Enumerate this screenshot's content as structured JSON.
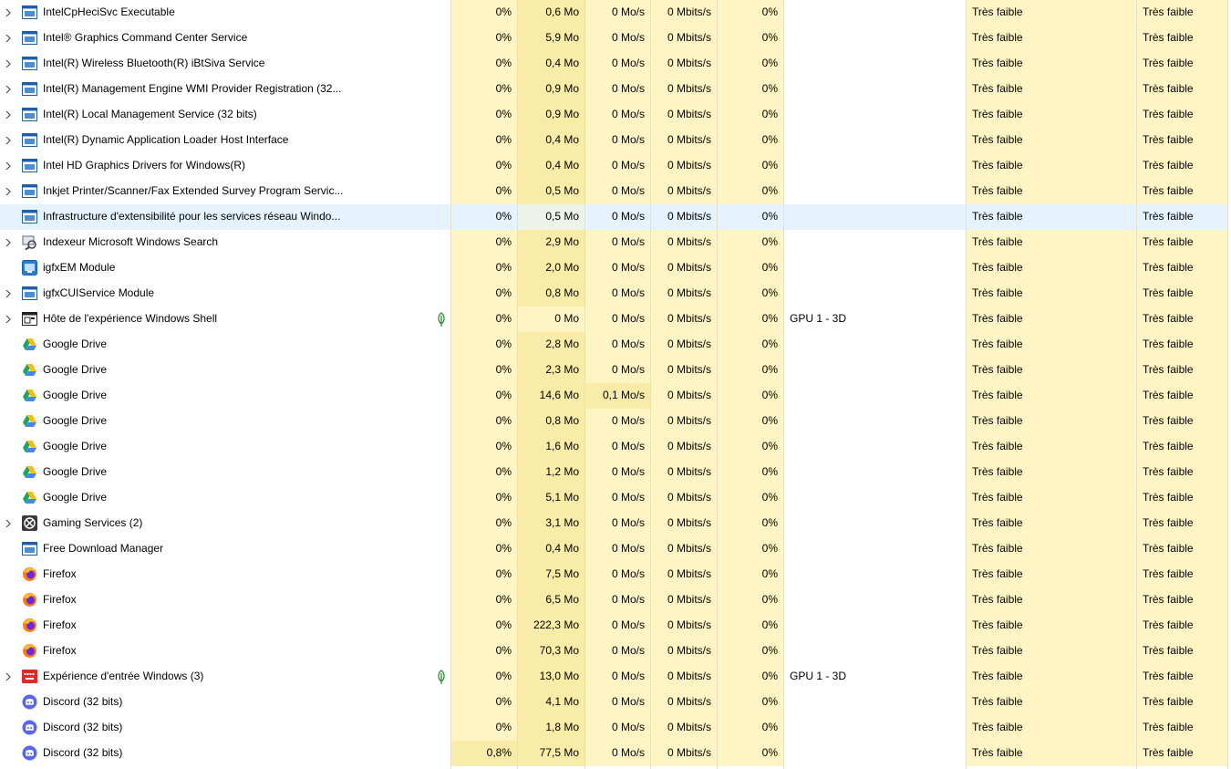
{
  "colors": {
    "heat": "#fff4c4",
    "heat_strong": "#f9eca8",
    "selection": "#e5f3ff",
    "leaf": "#2e8b2e"
  },
  "rows": [
    {
      "name": "IntelCpHeciSvc Executable",
      "icon": "service-window-icon",
      "expand": true,
      "cpu": "0%",
      "mem": "0,6 Mo",
      "disk": "0 Mo/s",
      "net": "0 Mbits/s",
      "gpu": "0%",
      "gpu_engine": "",
      "power": "Très faible",
      "power_trend": "Très faible"
    },
    {
      "name": "Intel® Graphics Command Center Service",
      "icon": "service-window-icon",
      "expand": true,
      "cpu": "0%",
      "mem": "5,9 Mo",
      "disk": "0 Mo/s",
      "net": "0 Mbits/s",
      "gpu": "0%",
      "gpu_engine": "",
      "power": "Très faible",
      "power_trend": "Très faible"
    },
    {
      "name": "Intel(R) Wireless Bluetooth(R) iBtSiva Service",
      "icon": "service-window-icon",
      "expand": true,
      "cpu": "0%",
      "mem": "0,4 Mo",
      "disk": "0 Mo/s",
      "net": "0 Mbits/s",
      "gpu": "0%",
      "gpu_engine": "",
      "power": "Très faible",
      "power_trend": "Très faible"
    },
    {
      "name": "Intel(R) Management Engine WMI Provider Registration (32...",
      "icon": "service-window-icon",
      "expand": true,
      "cpu": "0%",
      "mem": "0,9 Mo",
      "disk": "0 Mo/s",
      "net": "0 Mbits/s",
      "gpu": "0%",
      "gpu_engine": "",
      "power": "Très faible",
      "power_trend": "Très faible"
    },
    {
      "name": "Intel(R) Local Management Service (32 bits)",
      "icon": "service-window-icon",
      "expand": true,
      "cpu": "0%",
      "mem": "0,9 Mo",
      "disk": "0 Mo/s",
      "net": "0 Mbits/s",
      "gpu": "0%",
      "gpu_engine": "",
      "power": "Très faible",
      "power_trend": "Très faible"
    },
    {
      "name": "Intel(R) Dynamic Application Loader Host Interface",
      "icon": "service-window-icon",
      "expand": true,
      "cpu": "0%",
      "mem": "0,4 Mo",
      "disk": "0 Mo/s",
      "net": "0 Mbits/s",
      "gpu": "0%",
      "gpu_engine": "",
      "power": "Très faible",
      "power_trend": "Très faible"
    },
    {
      "name": "Intel HD Graphics Drivers for Windows(R)",
      "icon": "service-window-icon",
      "expand": true,
      "cpu": "0%",
      "mem": "0,4 Mo",
      "disk": "0 Mo/s",
      "net": "0 Mbits/s",
      "gpu": "0%",
      "gpu_engine": "",
      "power": "Très faible",
      "power_trend": "Très faible"
    },
    {
      "name": "Inkjet Printer/Scanner/Fax Extended Survey Program Servic...",
      "icon": "service-window-icon",
      "expand": true,
      "cpu": "0%",
      "mem": "0,5 Mo",
      "disk": "0 Mo/s",
      "net": "0 Mbits/s",
      "gpu": "0%",
      "gpu_engine": "",
      "power": "Très faible",
      "power_trend": "Très faible"
    },
    {
      "name": "Infrastructure d'extensibilité pour les services réseau Windo...",
      "icon": "service-window-icon",
      "expand": false,
      "selected": true,
      "cpu": "0%",
      "mem": "0,5 Mo",
      "disk": "0 Mo/s",
      "net": "0 Mbits/s",
      "gpu": "0%",
      "gpu_engine": "",
      "power": "Très faible",
      "power_trend": "Très faible"
    },
    {
      "name": "Indexeur Microsoft Windows Search",
      "icon": "search-indexer-icon",
      "expand": true,
      "cpu": "0%",
      "mem": "2,9 Mo",
      "disk": "0 Mo/s",
      "net": "0 Mbits/s",
      "gpu": "0%",
      "gpu_engine": "",
      "power": "Très faible",
      "power_trend": "Très faible"
    },
    {
      "name": "igfxEM Module",
      "icon": "igfx-module-icon",
      "expand": false,
      "cpu": "0%",
      "mem": "2,0 Mo",
      "disk": "0 Mo/s",
      "net": "0 Mbits/s",
      "gpu": "0%",
      "gpu_engine": "",
      "power": "Très faible",
      "power_trend": "Très faible"
    },
    {
      "name": "igfxCUIService Module",
      "icon": "service-window-icon",
      "expand": true,
      "cpu": "0%",
      "mem": "0,8 Mo",
      "disk": "0 Mo/s",
      "net": "0 Mbits/s",
      "gpu": "0%",
      "gpu_engine": "",
      "power": "Très faible",
      "power_trend": "Très faible"
    },
    {
      "name": "Hôte de l'expérience Windows Shell",
      "icon": "shell-host-icon",
      "expand": true,
      "leaf": true,
      "mem_plain": true,
      "cpu": "0%",
      "mem": "0 Mo",
      "disk": "0 Mo/s",
      "net": "0 Mbits/s",
      "gpu": "0%",
      "gpu_engine": "GPU 1 - 3D",
      "power": "Très faible",
      "power_trend": "Très faible"
    },
    {
      "name": "Google Drive",
      "icon": "google-drive-icon",
      "expand": false,
      "cpu": "0%",
      "mem": "2,8 Mo",
      "disk": "0 Mo/s",
      "net": "0 Mbits/s",
      "gpu": "0%",
      "gpu_engine": "",
      "power": "Très faible",
      "power_trend": "Très faible"
    },
    {
      "name": "Google Drive",
      "icon": "google-drive-icon",
      "expand": false,
      "cpu": "0%",
      "mem": "2,3 Mo",
      "disk": "0 Mo/s",
      "net": "0 Mbits/s",
      "gpu": "0%",
      "gpu_engine": "",
      "power": "Très faible",
      "power_trend": "Très faible"
    },
    {
      "name": "Google Drive",
      "icon": "google-drive-icon",
      "expand": false,
      "disk_strong": true,
      "cpu": "0%",
      "mem": "14,6 Mo",
      "disk": "0,1 Mo/s",
      "net": "0 Mbits/s",
      "gpu": "0%",
      "gpu_engine": "",
      "power": "Très faible",
      "power_trend": "Très faible"
    },
    {
      "name": "Google Drive",
      "icon": "google-drive-icon",
      "expand": false,
      "cpu": "0%",
      "mem": "0,8 Mo",
      "disk": "0 Mo/s",
      "net": "0 Mbits/s",
      "gpu": "0%",
      "gpu_engine": "",
      "power": "Très faible",
      "power_trend": "Très faible"
    },
    {
      "name": "Google Drive",
      "icon": "google-drive-icon",
      "expand": false,
      "cpu": "0%",
      "mem": "1,6 Mo",
      "disk": "0 Mo/s",
      "net": "0 Mbits/s",
      "gpu": "0%",
      "gpu_engine": "",
      "power": "Très faible",
      "power_trend": "Très faible"
    },
    {
      "name": "Google Drive",
      "icon": "google-drive-icon",
      "expand": false,
      "cpu": "0%",
      "mem": "1,2 Mo",
      "disk": "0 Mo/s",
      "net": "0 Mbits/s",
      "gpu": "0%",
      "gpu_engine": "",
      "power": "Très faible",
      "power_trend": "Très faible"
    },
    {
      "name": "Google Drive",
      "icon": "google-drive-icon",
      "expand": false,
      "cpu": "0%",
      "mem": "5,1 Mo",
      "disk": "0 Mo/s",
      "net": "0 Mbits/s",
      "gpu": "0%",
      "gpu_engine": "",
      "power": "Très faible",
      "power_trend": "Très faible"
    },
    {
      "name": "Gaming Services (2)",
      "icon": "xbox-icon",
      "expand": true,
      "cpu": "0%",
      "mem": "3,1 Mo",
      "disk": "0 Mo/s",
      "net": "0 Mbits/s",
      "gpu": "0%",
      "gpu_engine": "",
      "power": "Très faible",
      "power_trend": "Très faible"
    },
    {
      "name": "Free Download Manager",
      "icon": "service-window-icon",
      "expand": false,
      "cpu": "0%",
      "mem": "0,4 Mo",
      "disk": "0 Mo/s",
      "net": "0 Mbits/s",
      "gpu": "0%",
      "gpu_engine": "",
      "power": "Très faible",
      "power_trend": "Très faible"
    },
    {
      "name": "Firefox",
      "icon": "firefox-icon",
      "expand": false,
      "cpu": "0%",
      "mem": "7,5 Mo",
      "disk": "0 Mo/s",
      "net": "0 Mbits/s",
      "gpu": "0%",
      "gpu_engine": "",
      "power": "Très faible",
      "power_trend": "Très faible"
    },
    {
      "name": "Firefox",
      "icon": "firefox-icon",
      "expand": false,
      "cpu": "0%",
      "mem": "6,5 Mo",
      "disk": "0 Mo/s",
      "net": "0 Mbits/s",
      "gpu": "0%",
      "gpu_engine": "",
      "power": "Très faible",
      "power_trend": "Très faible"
    },
    {
      "name": "Firefox",
      "icon": "firefox-icon",
      "expand": false,
      "cpu": "0%",
      "mem": "222,3 Mo",
      "disk": "0 Mo/s",
      "net": "0 Mbits/s",
      "gpu": "0%",
      "gpu_engine": "",
      "power": "Très faible",
      "power_trend": "Très faible"
    },
    {
      "name": "Firefox",
      "icon": "firefox-icon",
      "expand": false,
      "cpu": "0%",
      "mem": "70,3 Mo",
      "disk": "0 Mo/s",
      "net": "0 Mbits/s",
      "gpu": "0%",
      "gpu_engine": "",
      "power": "Très faible",
      "power_trend": "Très faible"
    },
    {
      "name": "Expérience d'entrée Windows (3)",
      "icon": "input-experience-icon",
      "expand": true,
      "leaf": true,
      "cpu": "0%",
      "mem": "13,0 Mo",
      "disk": "0 Mo/s",
      "net": "0 Mbits/s",
      "gpu": "0%",
      "gpu_engine": "GPU 1 - 3D",
      "power": "Très faible",
      "power_trend": "Très faible"
    },
    {
      "name": "Discord (32 bits)",
      "icon": "discord-icon",
      "expand": false,
      "cpu": "0%",
      "mem": "4,1 Mo",
      "disk": "0 Mo/s",
      "net": "0 Mbits/s",
      "gpu": "0%",
      "gpu_engine": "",
      "power": "Très faible",
      "power_trend": "Très faible"
    },
    {
      "name": "Discord (32 bits)",
      "icon": "discord-icon",
      "expand": false,
      "cpu": "0%",
      "mem": "1,8 Mo",
      "disk": "0 Mo/s",
      "net": "0 Mbits/s",
      "gpu": "0%",
      "gpu_engine": "",
      "power": "Très faible",
      "power_trend": "Très faible"
    },
    {
      "name": "Discord (32 bits)",
      "icon": "discord-icon",
      "expand": false,
      "cpu_strong": true,
      "cpu": "0,8%",
      "mem": "77,5 Mo",
      "disk": "0 Mo/s",
      "net": "0 Mbits/s",
      "gpu": "0%",
      "gpu_engine": "",
      "power": "Très faible",
      "power_trend": "Très faible"
    }
  ]
}
